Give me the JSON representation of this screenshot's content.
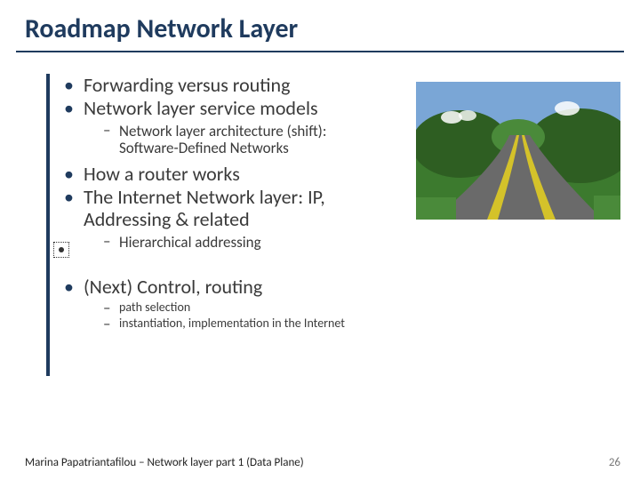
{
  "title": "Roadmap Network Layer",
  "bullets": {
    "b1": "Forwarding versus routing",
    "b2": "Network layer service models",
    "b2a": "Network layer architecture (shift): Software-Defined Networks",
    "b3": "How a router works",
    "b4": "The Internet Network layer: IP, Addressing & related",
    "b4a": "Hierarchical addressing",
    "b5": "(Next) Control, routing",
    "b5a": "path selection",
    "b5b": "instantiation, implementation in the Internet"
  },
  "footer": "Marina Papatriantafilou – Network layer part 1 (Data Plane)",
  "page": "26"
}
